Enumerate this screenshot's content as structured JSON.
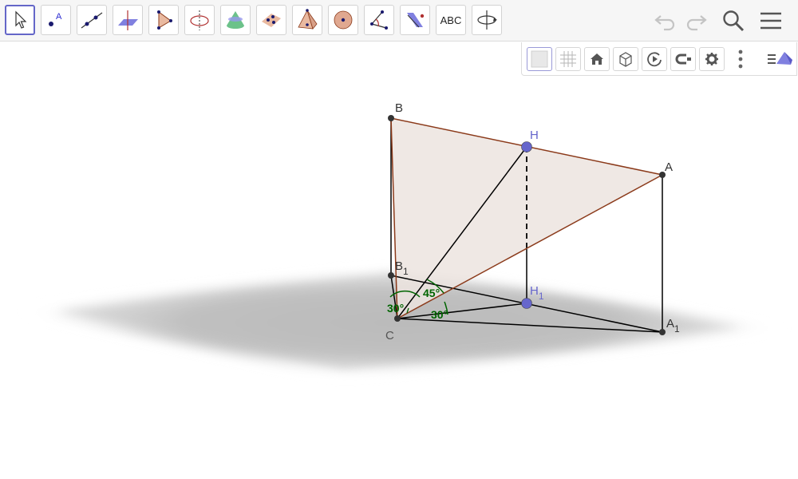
{
  "toolbar": {
    "tools": [
      {
        "name": "move-tool-icon"
      },
      {
        "name": "point-tool-icon",
        "text": "A"
      },
      {
        "name": "line-tool-icon"
      },
      {
        "name": "perpendicular-line-tool-icon"
      },
      {
        "name": "polygon-tool-icon"
      },
      {
        "name": "circle-axis-tool-icon"
      },
      {
        "name": "cone-tool-icon"
      },
      {
        "name": "plane-through-points-tool-icon"
      },
      {
        "name": "pyramid-tool-icon"
      },
      {
        "name": "sphere-tool-icon"
      },
      {
        "name": "angle-tool-icon"
      },
      {
        "name": "reflect-tool-icon"
      },
      {
        "name": "text-tool-icon",
        "text": "ABC"
      },
      {
        "name": "rotate-view-tool-icon"
      }
    ],
    "undo_icon": "undo-icon",
    "redo_icon": "redo-icon",
    "search_icon": "search-icon",
    "menu_icon": "hamburger-menu-icon"
  },
  "style_bar": {
    "buttons": [
      "axes-toggle",
      "grid-toggle",
      "standard-view",
      "view-direction",
      "rotate-view",
      "clipping",
      "settings",
      "more-options",
      "graphics-view-menu"
    ]
  },
  "scene": {
    "points": {
      "B": {
        "label": "B",
        "sub": ""
      },
      "H": {
        "label": "H",
        "sub": ""
      },
      "A": {
        "label": "A",
        "sub": ""
      },
      "B1": {
        "label": "B",
        "sub": "1"
      },
      "H1": {
        "label": "H",
        "sub": "1"
      },
      "C": {
        "label": "C",
        "sub": ""
      },
      "A1": {
        "label": "A",
        "sub": "1"
      }
    },
    "angles": {
      "left": "30°",
      "middle": "45°",
      "right": "30°"
    },
    "colors": {
      "plane": "#b3b3b3",
      "triangle_fill": "#eee5e1",
      "triangle_edge": "#8b3a1a",
      "point_blue": "#6666cc",
      "point_dark": "#333333",
      "angle_green": "#006400"
    }
  }
}
